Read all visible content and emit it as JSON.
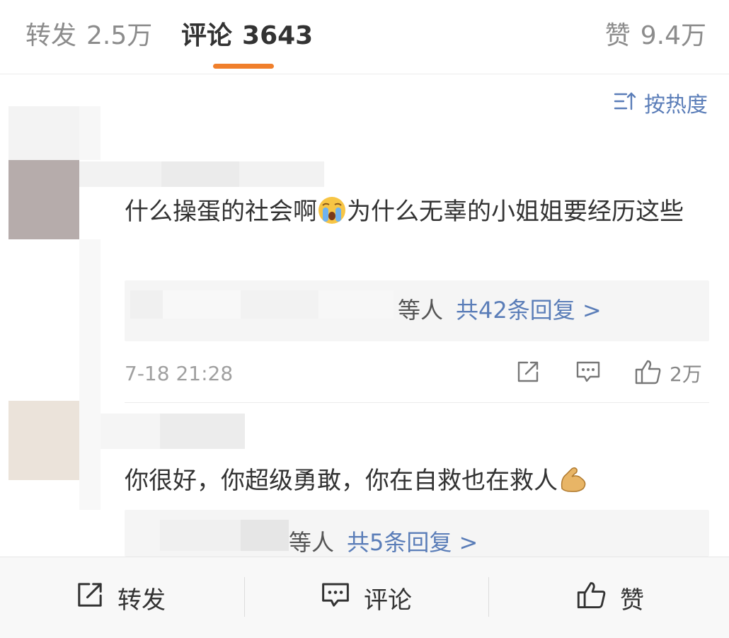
{
  "tabs": {
    "repost": {
      "label": "转发",
      "count": "2.5万"
    },
    "comments": {
      "label": "评论",
      "count": "3643"
    },
    "likes": {
      "label": "赞",
      "count": "9.4万"
    }
  },
  "sort": {
    "label": "按热度",
    "icon": "sort-lines-icon"
  },
  "comments": [
    {
      "text_before": "什么操蛋的社会啊",
      "emoji": "crying-face-emoji",
      "text_after": "为什么无辜的小姐姐要经历这些",
      "reply_suffix": "等人",
      "reply_count": "共42条回复 >",
      "time": "7-18 21:28",
      "like_count": "2万"
    },
    {
      "text_before": "你很好，你超级勇敢，你在自救也在救人",
      "emoji": "flexed-biceps-emoji",
      "reply_suffix": "等人",
      "reply_count": "共5条回复 >"
    }
  ],
  "bottom_bar": {
    "repost": "转发",
    "comment": "评论",
    "like": "赞"
  },
  "colors": {
    "accent": "#f07f2b",
    "link": "#5a7db8",
    "secondary": "#8c8c8c"
  }
}
